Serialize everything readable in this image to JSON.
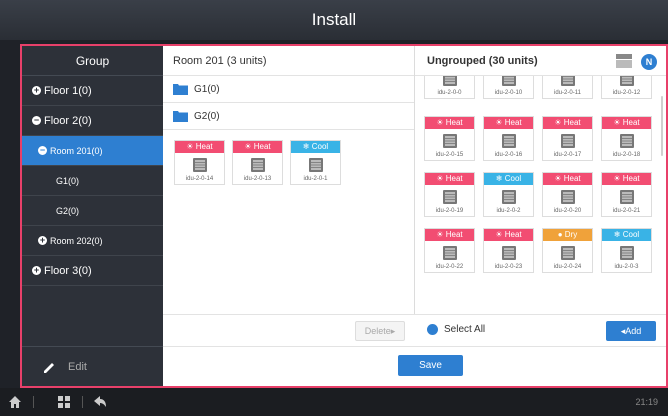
{
  "title": "Install",
  "sidebar": {
    "header": "Group",
    "items": [
      {
        "label": "Floor 1(0)",
        "sign": "+"
      },
      {
        "label": "Floor 2(0)",
        "sign": "−"
      },
      {
        "label": "Room 201(0)",
        "sign": "−"
      },
      {
        "label": "G1(0)",
        "sign": ""
      },
      {
        "label": "G2(0)",
        "sign": ""
      },
      {
        "label": "Room 202(0)",
        "sign": "+"
      },
      {
        "label": "Floor 3(0)",
        "sign": "+"
      }
    ],
    "edit_label": "Edit"
  },
  "room": {
    "header": "Room 201 (3 units)",
    "groups": [
      "G1(0)",
      "G2(0)"
    ],
    "units": [
      {
        "mode": "Heat",
        "name": "idu-2-0-14"
      },
      {
        "mode": "Heat",
        "name": "idu-2-0-13"
      },
      {
        "mode": "Cool",
        "name": "idu-2-0-1"
      }
    ],
    "delete_label": "Delete"
  },
  "ungrouped": {
    "header": "Ungrouped (30 units)",
    "badge": "N",
    "units": [
      {
        "mode": "",
        "name": "idu-2-0-0"
      },
      {
        "mode": "",
        "name": "idu-2-0-10"
      },
      {
        "mode": "",
        "name": "idu-2-0-11"
      },
      {
        "mode": "",
        "name": "idu-2-0-12"
      },
      {
        "mode": "Heat",
        "name": "idu-2-0-15"
      },
      {
        "mode": "Heat",
        "name": "idu-2-0-16"
      },
      {
        "mode": "Heat",
        "name": "idu-2-0-17"
      },
      {
        "mode": "Heat",
        "name": "idu-2-0-18"
      },
      {
        "mode": "Heat",
        "name": "idu-2-0-19"
      },
      {
        "mode": "Cool",
        "name": "idu-2-0-2"
      },
      {
        "mode": "Heat",
        "name": "idu-2-0-20"
      },
      {
        "mode": "Heat",
        "name": "idu-2-0-21"
      },
      {
        "mode": "Heat",
        "name": "idu-2-0-22"
      },
      {
        "mode": "Heat",
        "name": "idu-2-0-23"
      },
      {
        "mode": "Dry",
        "name": "idu-2-0-24"
      },
      {
        "mode": "Cool",
        "name": "idu-2-0-3"
      }
    ],
    "select_all_label": "Select All",
    "add_label": "Add"
  },
  "save_label": "Save",
  "taskbar": {
    "time": "21:19"
  },
  "colors": {
    "accent": "#2e7fd1",
    "frame": "#e8406a",
    "heat": "#f24d72",
    "cool": "#39b3e6",
    "dry": "#f0a23a"
  }
}
